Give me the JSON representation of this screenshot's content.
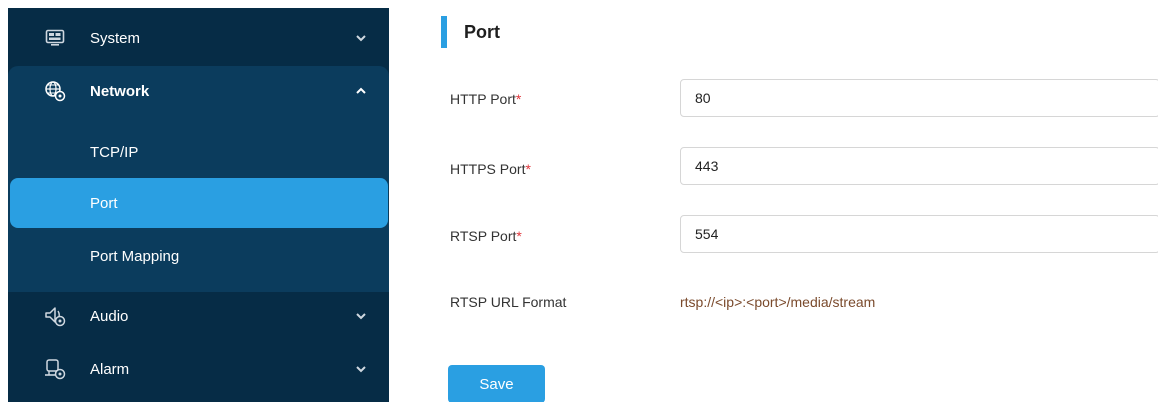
{
  "sidebar": {
    "system": {
      "label": "System",
      "icon": "monitor-icon"
    },
    "network": {
      "label": "Network",
      "icon": "globe-gear-icon"
    },
    "network_items": [
      {
        "label": "TCP/IP",
        "active": false
      },
      {
        "label": "Port",
        "active": true
      },
      {
        "label": "Port Mapping",
        "active": false
      }
    ],
    "audio": {
      "label": "Audio",
      "icon": "speaker-gear-icon"
    },
    "alarm": {
      "label": "Alarm",
      "icon": "alarm-gear-icon"
    }
  },
  "main": {
    "title": "Port",
    "fields": {
      "http": {
        "label": "HTTP Port",
        "required_mark": "*",
        "value": "80"
      },
      "https": {
        "label": "HTTPS Port",
        "required_mark": "*",
        "value": "443"
      },
      "rtsp": {
        "label": "RTSP Port",
        "required_mark": "*",
        "value": "554"
      }
    },
    "rtsp_url": {
      "label": "RTSP URL Format",
      "value": "rtsp://<ip>:<port>/media/stream"
    },
    "save_label": "Save"
  },
  "colors": {
    "sidebar_bg": "#062c46",
    "submenu_bg": "#0b3c5d",
    "accent": "#2a9fe2",
    "required": "#e0353b",
    "url_text": "#7a4a2c"
  }
}
